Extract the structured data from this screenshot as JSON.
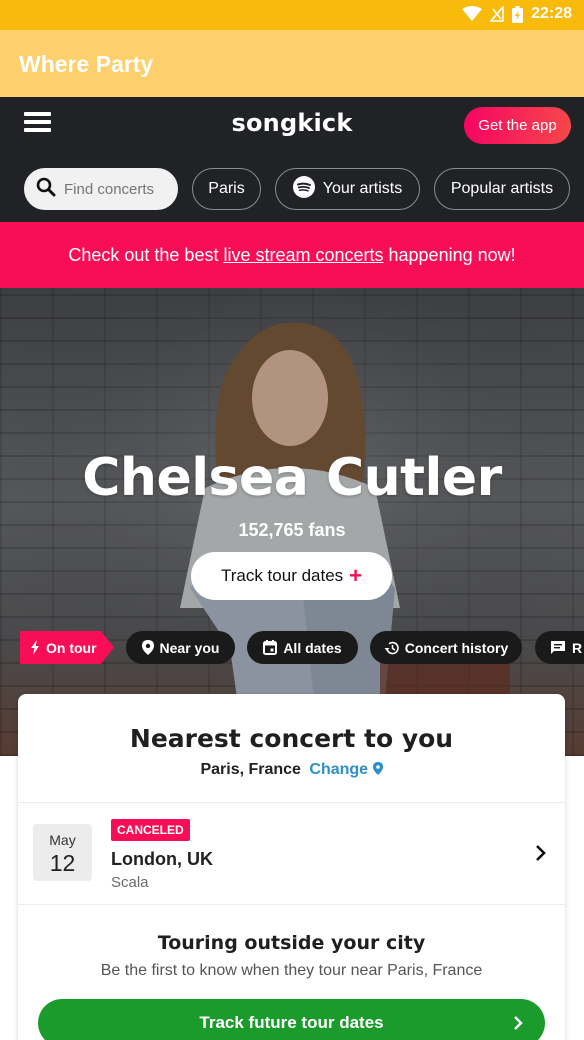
{
  "status_bar": {
    "time": "22:28",
    "icons": [
      "wifi-icon",
      "signal-icon",
      "battery-icon"
    ]
  },
  "app_bar": {
    "title": "Where Party"
  },
  "header": {
    "logo": "songkick",
    "get_app": "Get the app",
    "menu_icon": "menu-icon"
  },
  "filters": {
    "search_placeholder": "Find concerts",
    "location": "Paris",
    "your_artists": "Your artists",
    "popular_artists": "Popular artists"
  },
  "promo": {
    "before": "Check out the best ",
    "link": "live stream concerts",
    "after": " happening now!"
  },
  "artist": {
    "name": "Chelsea Cutler",
    "fans": "152,765 fans",
    "track_button": "Track tour dates",
    "track_plus": "+"
  },
  "tabs": [
    {
      "label": "On tour",
      "icon": "lightning-icon"
    },
    {
      "label": "Near you",
      "icon": "location-pin-icon"
    },
    {
      "label": "All dates",
      "icon": "calendar-icon"
    },
    {
      "label": "Concert history",
      "icon": "history-icon"
    },
    {
      "label": "R",
      "icon": "reviews-icon"
    }
  ],
  "nearest": {
    "title": "Nearest concert to you",
    "location": "Paris, France",
    "change": "Change",
    "event": {
      "month": "May",
      "day": "12",
      "status": "CANCELED",
      "city": "London, UK",
      "venue": "Scala"
    },
    "touring_title": "Touring outside your city",
    "touring_sub": "Be the first to know when they tour near Paris, France",
    "track_future": "Track future tour dates"
  },
  "colors": {
    "status_bar": "#f8ba0b",
    "app_bar": "#fecf6d",
    "header": "#212226",
    "brand_pink": "#f80e56",
    "link_blue": "#2f8fc9",
    "cta_green": "#1a9b2c"
  }
}
